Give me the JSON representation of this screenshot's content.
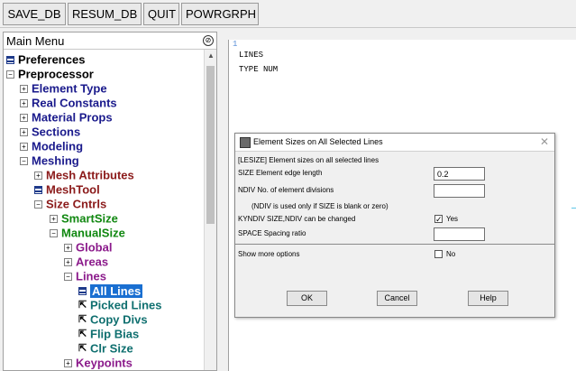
{
  "toolbar": {
    "buttons": [
      "SAVE_DB",
      "RESUM_DB",
      "QUIT",
      "POWRGRPH"
    ]
  },
  "menu": {
    "title": "Main Menu",
    "collapse_icon": "⊘",
    "items": [
      {
        "label": "Preferences",
        "icon": "leaf-box"
      },
      {
        "label": "Preprocessor",
        "icon": "minus"
      },
      {
        "label": "Element Type",
        "icon": "plus"
      },
      {
        "label": "Real Constants",
        "icon": "plus"
      },
      {
        "label": "Material Props",
        "icon": "plus"
      },
      {
        "label": "Sections",
        "icon": "plus"
      },
      {
        "label": "Modeling",
        "icon": "plus"
      },
      {
        "label": "Meshing",
        "icon": "minus"
      },
      {
        "label": "Mesh Attributes",
        "icon": "plus"
      },
      {
        "label": "MeshTool",
        "icon": "leaf-box"
      },
      {
        "label": "Size Cntrls",
        "icon": "minus"
      },
      {
        "label": "SmartSize",
        "icon": "plus"
      },
      {
        "label": "ManualSize",
        "icon": "minus"
      },
      {
        "label": "Global",
        "icon": "plus"
      },
      {
        "label": "Areas",
        "icon": "plus"
      },
      {
        "label": "Lines",
        "icon": "minus"
      },
      {
        "label": "All Lines",
        "icon": "leaf-box"
      },
      {
        "label": "Picked Lines",
        "icon": "arrow"
      },
      {
        "label": "Copy Divs",
        "icon": "arrow"
      },
      {
        "label": "Flip Bias",
        "icon": "arrow"
      },
      {
        "label": "Clr Size",
        "icon": "arrow"
      },
      {
        "label": "Keypoints",
        "icon": "plus"
      }
    ]
  },
  "graphics": {
    "window_number": "1",
    "lines": [
      "LINES",
      "TYPE NUM"
    ]
  },
  "dialog": {
    "title": "Element Sizes on All Selected Lines",
    "header": "[LESIZE]  Element sizes on all selected lines",
    "size_label": "SIZE   Element edge length",
    "size_value": "0.2",
    "ndiv_label": "NDIV    No. of element divisions",
    "ndiv_value": "",
    "ndiv_note": "(NDIV is used only if SIZE is blank or zero)",
    "kyndiv_label": "KYNDIV  SIZE,NDIV can be changed",
    "kyndiv_checked": true,
    "kyndiv_state": "Yes",
    "space_label": "SPACE   Spacing ratio",
    "space_value": "",
    "more_options_label": "Show more options",
    "more_options_checked": false,
    "more_options_state": "No",
    "ok_label": "OK",
    "cancel_label": "Cancel",
    "help_label": "Help"
  }
}
